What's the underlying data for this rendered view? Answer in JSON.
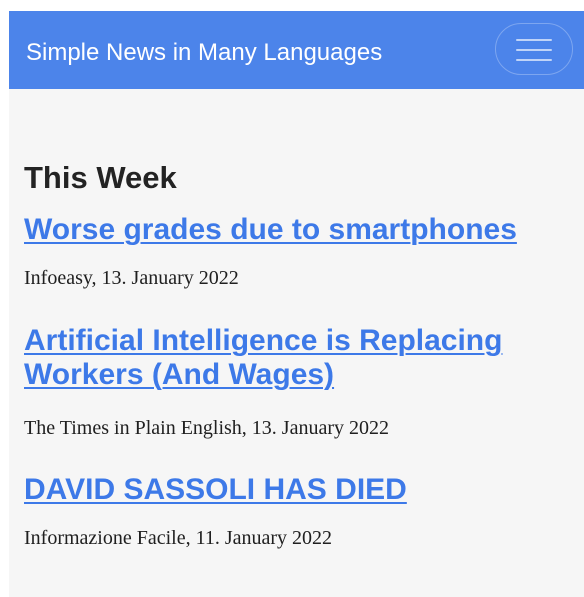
{
  "header": {
    "brand": "Simple News in Many Languages",
    "menu_icon": "hamburger-menu-icon"
  },
  "main": {
    "section_title": "This Week",
    "articles": [
      {
        "title": "Worse grades due to smartphones",
        "source_date": "Infoeasy, 13. January 2022"
      },
      {
        "title": "Artificial Intelligence is Replacing Workers (And Wages)",
        "source_date": "The Times in Plain English, 13. January 2022"
      },
      {
        "title": "DAVID SASSOLI HAS DIED",
        "source_date": "Informazione Facile, 11. January 2022"
      }
    ]
  },
  "colors": {
    "header_background": "#4C84EA",
    "page_background": "#F6F6F6",
    "link": "#3D79E8",
    "title_text": "#232323",
    "body_text": "#202020"
  }
}
